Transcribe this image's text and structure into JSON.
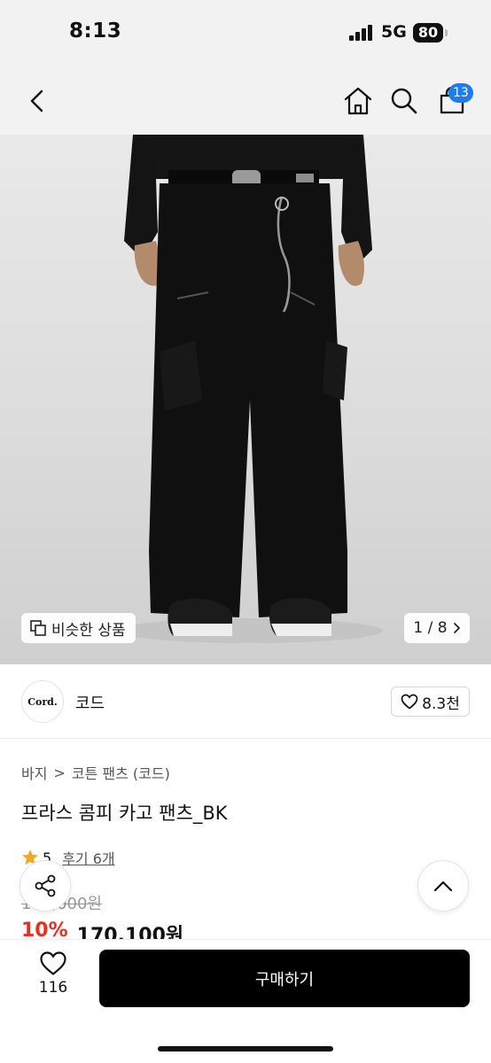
{
  "status_bar": {
    "time": "8:13",
    "network": "5G",
    "battery": "80"
  },
  "header": {
    "back_icon": "chevron-left-icon",
    "home_icon": "home-icon",
    "search_icon": "search-icon",
    "cart_icon": "shopping-bag-icon",
    "cart_count": "13",
    "badge_color": "#1f7bf2"
  },
  "gallery": {
    "similar_label": "비슷한 상품",
    "counter": "1 / 8"
  },
  "brand": {
    "logo_text": "Cord.",
    "name": "코드",
    "likes": "8.3천"
  },
  "product": {
    "breadcrumb": [
      "바지",
      "코튼 팬츠 (코드)"
    ],
    "title": "프라스 콤피 카고 팬츠_BK",
    "rating": "5",
    "review_label": "후기 6개",
    "original_price": "189,000원",
    "discount": "10%",
    "price": "170,100원",
    "discount_color": "#ea2e20"
  },
  "bottom_bar": {
    "wish_count": "116",
    "buy_label": "구매하기"
  }
}
